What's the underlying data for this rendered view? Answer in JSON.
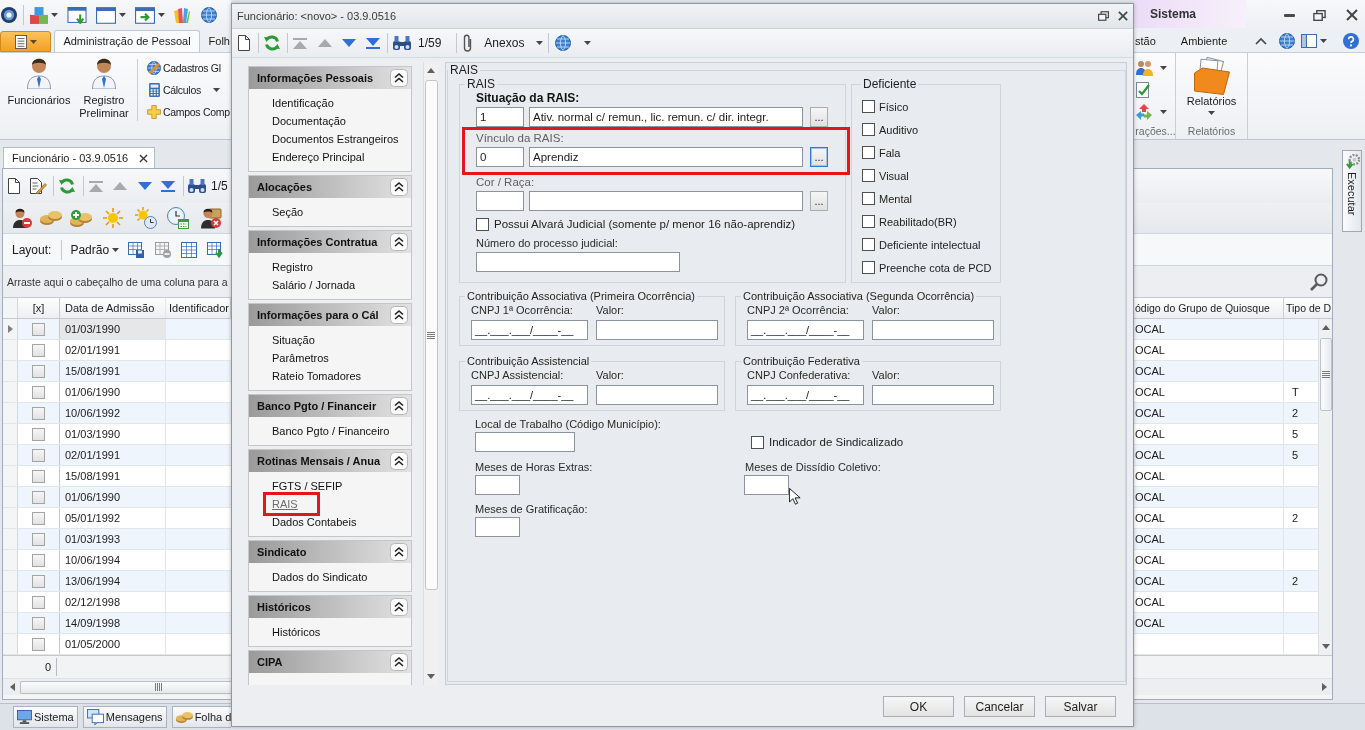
{
  "window": {
    "title": "Sistema"
  },
  "ribbon": {
    "tabs": [
      {
        "label": "Administração de Pessoal",
        "selected": true
      },
      {
        "label": "Folh",
        "selected": false
      }
    ],
    "right_tabs": [
      {
        "label": "stão",
        "selected": false
      },
      {
        "label": "Ambiente",
        "selected": false
      }
    ],
    "large_buttons": [
      {
        "label": "Funcionários"
      },
      {
        "label": "Registro Preliminar"
      }
    ],
    "small_buttons": [
      {
        "label": "Cadastros Gl",
        "dropdown": false
      },
      {
        "label": "Cálculos",
        "dropdown": true
      },
      {
        "label": "Campos Comp",
        "dropdown": false
      }
    ],
    "right_group": {
      "label": "rações..."
    },
    "reports": {
      "label": "Relatórios",
      "group_label": "Relatórios"
    }
  },
  "document": {
    "tab": "Funcionário - 03.9.0516",
    "toolbar": {
      "nav_buttons": [
        {
          "kind": "first",
          "disabled": true
        },
        {
          "kind": "previous",
          "disabled": true
        },
        {
          "kind": "next",
          "disabled": false
        },
        {
          "kind": "last",
          "disabled": false
        }
      ],
      "counter": "1/5"
    },
    "layout": {
      "label": "Layout:",
      "value": "Padrão"
    },
    "group_hint": "Arraste aqui o cabeçalho de uma coluna para a",
    "grid": {
      "columns": [
        "[x]",
        "Data de Admissão",
        "Identificador"
      ],
      "right_columns": [
        "ódigo do Grupo de Quiosque",
        "Tipo de D"
      ],
      "rows": [
        {
          "selected": true,
          "checked": false,
          "admission": "01/03/1990",
          "group_code": "OCAL"
        },
        {
          "selected": false,
          "checked": false,
          "admission": "02/01/1991",
          "group_code": "OCAL"
        },
        {
          "selected": false,
          "checked": false,
          "admission": "15/08/1991",
          "group_code": "OCAL"
        },
        {
          "selected": false,
          "checked": false,
          "admission": "01/06/1990",
          "group_code": "OCAL",
          "type": "T"
        },
        {
          "selected": false,
          "checked": false,
          "admission": "10/06/1992",
          "group_code": "OCAL",
          "type": "2"
        },
        {
          "selected": false,
          "checked": false,
          "admission": "01/03/1990",
          "group_code": "OCAL",
          "type": "5"
        },
        {
          "selected": false,
          "checked": false,
          "admission": "02/01/1991",
          "group_code": "OCAL",
          "type": "5"
        },
        {
          "selected": false,
          "checked": false,
          "admission": "15/08/1991",
          "group_code": "OCAL"
        },
        {
          "selected": false,
          "checked": false,
          "admission": "01/06/1990",
          "group_code": "OCAL"
        },
        {
          "selected": false,
          "checked": false,
          "admission": "05/01/1992",
          "group_code": "OCAL",
          "type": "2"
        },
        {
          "selected": false,
          "checked": false,
          "admission": "01/03/1993",
          "group_code": "OCAL"
        },
        {
          "selected": false,
          "checked": false,
          "admission": "10/06/1994",
          "group_code": "OCAL"
        },
        {
          "selected": false,
          "checked": false,
          "admission": "13/06/1994",
          "group_code": "OCAL",
          "type": "2"
        },
        {
          "selected": false,
          "checked": false,
          "admission": "02/12/1998",
          "group_code": "OCAL"
        },
        {
          "selected": false,
          "checked": false,
          "admission": "14/09/1998",
          "group_code": "OCAL"
        },
        {
          "selected": false,
          "checked": false,
          "admission": "01/05/2000"
        }
      ],
      "footer": "0"
    }
  },
  "side_panel": {
    "label": "Executar"
  },
  "taskbar": [
    {
      "label": "Sistema"
    },
    {
      "label": "Mensagens"
    },
    {
      "label": "Folha d"
    }
  ],
  "dialog": {
    "title": "Funcionário: <novo> - 03.9.0516",
    "toolbar": {
      "nav_buttons": [
        {
          "kind": "first",
          "disabled": true
        },
        {
          "kind": "previous",
          "disabled": true
        },
        {
          "kind": "next",
          "disabled": false
        },
        {
          "kind": "last",
          "disabled": false
        }
      ],
      "counter": "1/59",
      "attachments": "Anexos"
    },
    "nav": [
      {
        "title": "Informações Pessoais",
        "expanded": true,
        "items": [
          {
            "label": "Identificação",
            "selected": false,
            "highlighted": false
          },
          {
            "label": "Documentação",
            "selected": false,
            "highlighted": false
          },
          {
            "label": "Documentos Estrangeiros",
            "selected": false,
            "highlighted": false
          },
          {
            "label": "Endereço Principal",
            "selected": false,
            "highlighted": false
          }
        ]
      },
      {
        "title": "Alocações",
        "expanded": true,
        "items": [
          {
            "label": "Seção",
            "selected": false,
            "highlighted": false
          }
        ]
      },
      {
        "title": "Informações Contratua",
        "expanded": true,
        "items": [
          {
            "label": "Registro",
            "selected": false,
            "highlighted": false
          },
          {
            "label": "Salário / Jornada",
            "selected": false,
            "highlighted": false
          }
        ]
      },
      {
        "title": "Informações para o Cál",
        "expanded": true,
        "items": [
          {
            "label": "Situação",
            "selected": false,
            "highlighted": false
          },
          {
            "label": "Parâmetros",
            "selected": false,
            "highlighted": false
          },
          {
            "label": "Rateio Tomadores",
            "selected": false,
            "highlighted": false
          }
        ]
      },
      {
        "title": "Banco Pgto / Financeir",
        "expanded": true,
        "items": [
          {
            "label": "Banco Pgto / Financeiro",
            "selected": false,
            "highlighted": false
          }
        ]
      },
      {
        "title": "Rotinas Mensais / Anua",
        "expanded": true,
        "items": [
          {
            "label": "FGTS / SEFIP",
            "selected": false,
            "highlighted": false
          },
          {
            "label": "RAIS",
            "selected": true,
            "highlighted": true
          },
          {
            "label": "Dados Contabeis",
            "selected": false,
            "highlighted": false
          }
        ]
      },
      {
        "title": "Sindicato",
        "expanded": true,
        "items": [
          {
            "label": "Dados do Sindicato",
            "selected": false,
            "highlighted": false
          }
        ]
      },
      {
        "title": "Históricos",
        "expanded": true,
        "items": [
          {
            "label": "Históricos",
            "selected": false,
            "highlighted": false
          }
        ]
      },
      {
        "title": "CIPA",
        "expanded": true
      }
    ],
    "section_title": "RAIS",
    "rais": {
      "title": "RAIS",
      "lookups": [
        {
          "label": "Situação da RAIS:",
          "required": true,
          "code": "1",
          "description": "Ativ. normal c/ remun., lic. remun. c/ dir. integr.",
          "button": "...",
          "focused": false,
          "highlighted": false
        },
        {
          "label": "Vínculo da RAIS:",
          "required": false,
          "code": "0",
          "description": "Aprendiz",
          "button": "...",
          "focused": true,
          "highlighted": true
        },
        {
          "label": "Cor / Raça:",
          "required": false,
          "button": "...",
          "focused": false,
          "highlighted": false
        }
      ],
      "alvara": {
        "label": "Possui Alvará Judicial (somente p/ menor 16 não-aprendiz)",
        "checked": false
      },
      "process_number": {
        "label": "Número do processo judicial:"
      }
    },
    "deficiente": {
      "title": "Deficiente",
      "options": [
        {
          "label": "Físico",
          "checked": false
        },
        {
          "label": "Auditivo",
          "checked": false
        },
        {
          "label": "Fala",
          "checked": false
        },
        {
          "label": "Visual",
          "checked": false
        },
        {
          "label": "Mental",
          "checked": false
        },
        {
          "label": "Reabilitado(BR)",
          "checked": false
        },
        {
          "label": "Deficiente intelectual",
          "checked": false
        },
        {
          "label": "Preenche cota de PCD",
          "checked": false
        }
      ]
    },
    "contributions": [
      {
        "title": "Contribuição Associativa (Primeira Ocorrência)",
        "cnpj_label": "CNPJ 1ª Ocorrência:",
        "cnpj_value": "__.___.___/____-__",
        "value_label": "Valor:"
      },
      {
        "title": "Contribuição Associativa (Segunda Ocorrência)",
        "cnpj_label": "CNPJ 2ª Ocorrência:",
        "cnpj_value": "__.___.___/____-__",
        "value_label": "Valor:"
      },
      {
        "title": "Contribuição Assistencial",
        "cnpj_label": "CNPJ Assistencial:",
        "cnpj_value": "__.___.___/____-__",
        "value_label": "Valor:"
      },
      {
        "title": "Contribuição Federativa",
        "cnpj_label": "CNPJ Confederativa:",
        "cnpj_value": "__.___.___/____-__",
        "value_label": "Valor:"
      }
    ],
    "workplace": {
      "label": "Local de Trabalho (Código Município):"
    },
    "union_member": {
      "label": "Indicador de Sindicalizado",
      "checked": false
    },
    "overtime_months": {
      "label": "Meses de Horas Extras:"
    },
    "collective_months": {
      "label": "Meses de Dissídio Coletivo:"
    },
    "bonus_months": {
      "label": "Meses de Gratificação:"
    },
    "buttons": [
      "OK",
      "Cancelar",
      "Salvar"
    ]
  }
}
